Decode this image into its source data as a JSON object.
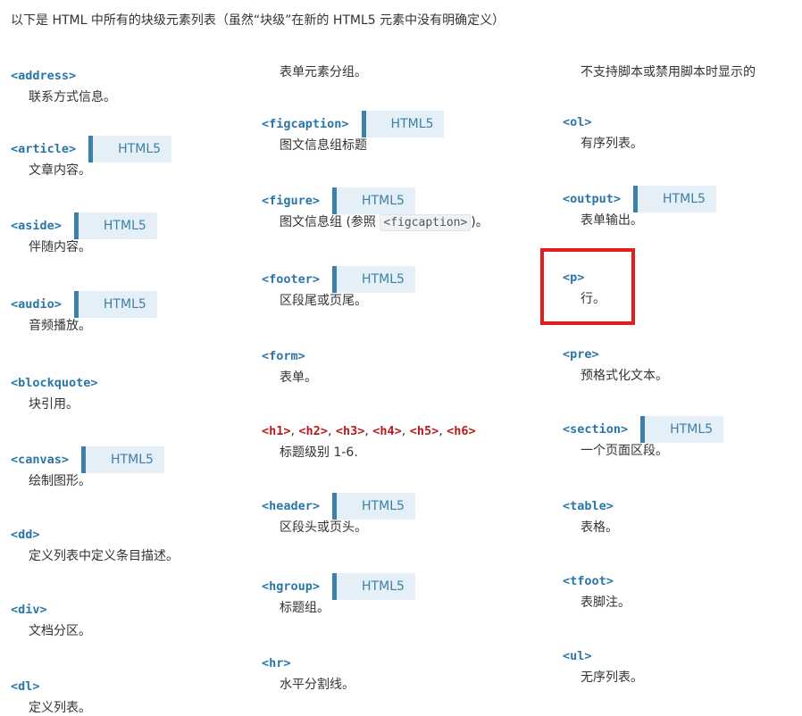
{
  "intro": "以下是 HTML 中所有的块级元素列表（虽然“块级”在新的 HTML5 元素中没有明确定义）",
  "badge_label": "HTML5",
  "col1": [
    {
      "tag": "<address>",
      "desc": "联系方式信息。"
    },
    {
      "tag": "<article>",
      "desc": "文章内容。"
    },
    {
      "tag": "<aside>",
      "desc": "伴随内容。"
    },
    {
      "tag": "<audio>",
      "desc": "音频播放。"
    },
    {
      "tag": "<blockquote>",
      "desc": "块引用。"
    },
    {
      "tag": "<canvas>",
      "desc": "绘制图形。"
    },
    {
      "tag": "<dd>",
      "desc": "定义列表中定义条目描述。"
    },
    {
      "tag": "<div>",
      "desc": "文档分区。"
    },
    {
      "tag": "<dl>",
      "desc": "定义列表。"
    }
  ],
  "col2": [
    {
      "desc": "表单元素分组。"
    },
    {
      "tag": "<figcaption>",
      "desc": "图文信息组标题"
    },
    {
      "tag": "<figure>",
      "desc_prefix": "图文信息组 (参照 ",
      "desc_code": "<figcaption>",
      "desc_suffix": ")。"
    },
    {
      "tag": "<footer>",
      "desc": "区段尾或页尾。"
    },
    {
      "tag": "<form>",
      "desc": "表单。"
    },
    {
      "tags": [
        "<h1>",
        "<h2>",
        "<h3>",
        "<h4>",
        "<h5>",
        "<h6>"
      ],
      "desc": "标题级别 1-6."
    },
    {
      "tag": "<header>",
      "desc": "区段头或页头。"
    },
    {
      "tag": "<hgroup>",
      "desc": "标题组。"
    },
    {
      "tag": "<hr>",
      "desc": "水平分割线。"
    }
  ],
  "col3": [
    {
      "desc": "不支持脚本或禁用脚本时显示的"
    },
    {
      "tag": "<ol>",
      "desc": "有序列表。"
    },
    {
      "tag": "<output>",
      "desc": "表单输出。"
    },
    {
      "tag": "<p>",
      "desc": "行。"
    },
    {
      "tag": "<pre>",
      "desc": "预格式化文本。"
    },
    {
      "tag": "<section>",
      "desc": "一个页面区段。"
    },
    {
      "tag": "<table>",
      "desc": "表格。"
    },
    {
      "tag": "<tfoot>",
      "desc": "表脚注。"
    },
    {
      "tag": "<ul>",
      "desc": "无序列表。"
    }
  ],
  "colors": {
    "tag": "#2a76a8",
    "heading_tag": "#b71c1c",
    "badge_bg": "#e4eff7",
    "badge_border": "#3d7fa6",
    "highlight": "#e11c1c"
  }
}
